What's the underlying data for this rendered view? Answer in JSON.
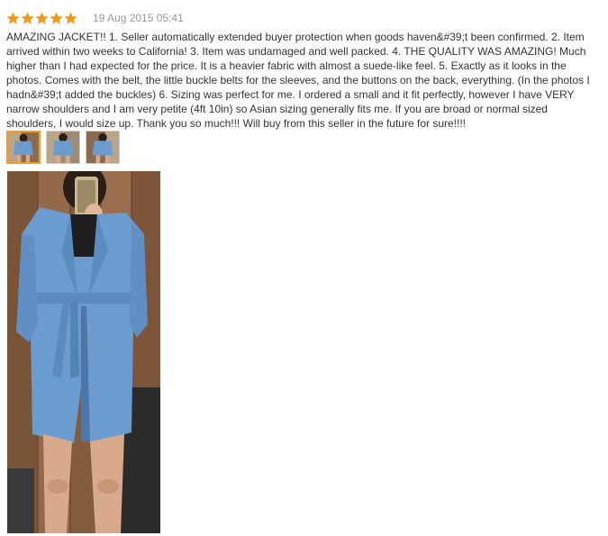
{
  "review": {
    "rating": {
      "stars": 5,
      "max": 5,
      "color": "#f39c12"
    },
    "date": "19 Aug 2015 05:41",
    "text": "AMAZING JACKET!! 1. Seller automatically extended buyer protection when goods haven&#39;t been confirmed. 2. Item arrived within two weeks to California! 3. Item was undamaged and well packed. 4. THE QUALITY WAS AMAZING! Much higher than I had expected for the price. It is a heavier fabric with almost a suede-like feel. 5. Exactly as it looks in the photos. Comes with the belt, the little buckle belts for the sleeves, and the buttons on the back, everything. (In the photos I hadn&#39;t added the buckles) 6. Sizing was perfect for me. I ordered a small and it fit perfectly, however I have VERY narrow shoulders and I am very petite (4ft 10in) so Asian sizing generally fits me. If you are broad or normal sized shoulders, I would size up. Thank you so much!!! Will buy from this seller in the future for sure!!!!",
    "photos": [
      {
        "name": "thumbnail-1",
        "selected": true
      },
      {
        "name": "thumbnail-2",
        "selected": false
      },
      {
        "name": "thumbnail-3",
        "selected": false
      }
    ],
    "colors": {
      "accent": "#f29e21",
      "text": "#333333",
      "date": "#999999",
      "jacket": "#6a9ccf"
    }
  }
}
